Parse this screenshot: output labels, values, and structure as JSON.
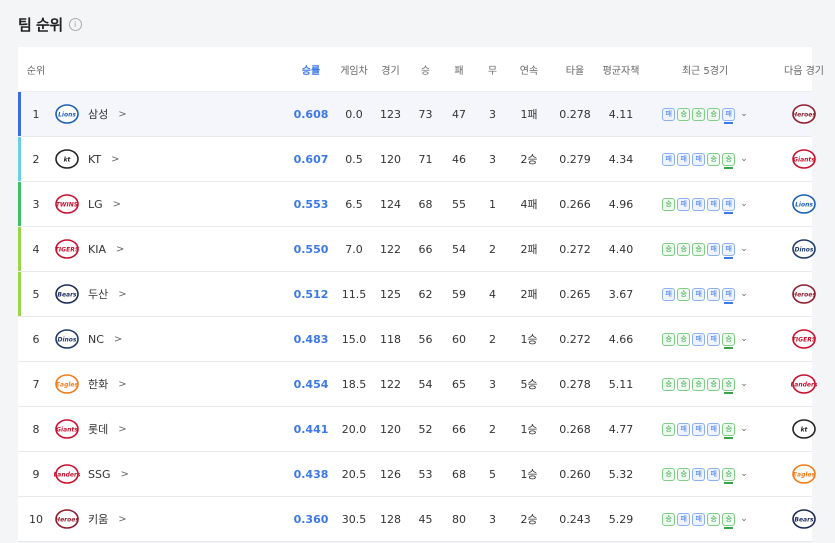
{
  "page_title": "팀 순위",
  "info_icon": "i",
  "columns": {
    "rank": "순위",
    "pct": "승률",
    "gb": "게임차",
    "games": "경기",
    "wins": "승",
    "losses": "패",
    "draws": "무",
    "streak": "연속",
    "avg": "타율",
    "era": "평균자책",
    "last5": "최근 5경기",
    "next": "다음 경기"
  },
  "teams": [
    {
      "rank": "1",
      "name": "삼성",
      "pct": "0.608",
      "gb": "0.0",
      "games": "123",
      "wins": "73",
      "losses": "47",
      "draws": "3",
      "streak": "1패",
      "avg": "0.278",
      "era": "4.11",
      "last5": [
        "패",
        "승",
        "승",
        "승",
        "패"
      ],
      "bar": "#3c6be0",
      "logo": "Lions",
      "logo_color": "#1a5fb4",
      "next_logo": "Heroes",
      "next_color": "#8e1c2e"
    },
    {
      "rank": "2",
      "name": "KT",
      "pct": "0.607",
      "gb": "0.5",
      "games": "120",
      "wins": "71",
      "losses": "46",
      "draws": "3",
      "streak": "2승",
      "avg": "0.279",
      "era": "4.34",
      "last5": [
        "패",
        "패",
        "패",
        "승",
        "승"
      ],
      "bar": "#6bd0e6",
      "logo": "kt",
      "logo_color": "#222",
      "next_logo": "Giants",
      "next_color": "#c8102e"
    },
    {
      "rank": "3",
      "name": "LG",
      "pct": "0.553",
      "gb": "6.5",
      "games": "124",
      "wins": "68",
      "losses": "55",
      "draws": "1",
      "streak": "4패",
      "avg": "0.266",
      "era": "4.96",
      "last5": [
        "승",
        "패",
        "패",
        "패",
        "패"
      ],
      "bar": "#3fbd6a",
      "logo": "TWINS",
      "logo_color": "#c8102e",
      "next_logo": "Lions",
      "next_color": "#1a5fb4"
    },
    {
      "rank": "4",
      "name": "KIA",
      "pct": "0.550",
      "gb": "7.0",
      "games": "122",
      "wins": "66",
      "losses": "54",
      "draws": "2",
      "streak": "2패",
      "avg": "0.272",
      "era": "4.40",
      "last5": [
        "승",
        "승",
        "승",
        "패",
        "패"
      ],
      "bar": "#9ad64a",
      "logo": "TIGERS",
      "logo_color": "#c8102e",
      "next_logo": "Dinos",
      "next_color": "#1f3a6b"
    },
    {
      "rank": "5",
      "name": "두산",
      "pct": "0.512",
      "gb": "11.5",
      "games": "125",
      "wins": "62",
      "losses": "59",
      "draws": "4",
      "streak": "2패",
      "avg": "0.265",
      "era": "3.67",
      "last5": [
        "패",
        "승",
        "패",
        "패",
        "패"
      ],
      "bar": "#9ad64a",
      "logo": "Bears",
      "logo_color": "#1c2a5a",
      "next_logo": "Heroes",
      "next_color": "#8e1c2e"
    },
    {
      "rank": "6",
      "name": "NC",
      "pct": "0.483",
      "gb": "15.0",
      "games": "118",
      "wins": "56",
      "losses": "60",
      "draws": "2",
      "streak": "1승",
      "avg": "0.272",
      "era": "4.66",
      "last5": [
        "승",
        "승",
        "패",
        "패",
        "승"
      ],
      "bar": "",
      "logo": "Dinos",
      "logo_color": "#1f3a6b",
      "next_logo": "TIGERS",
      "next_color": "#c8102e"
    },
    {
      "rank": "7",
      "name": "한화",
      "pct": "0.454",
      "gb": "18.5",
      "games": "122",
      "wins": "54",
      "losses": "65",
      "draws": "3",
      "streak": "5승",
      "avg": "0.278",
      "era": "5.11",
      "last5": [
        "승",
        "승",
        "승",
        "승",
        "승"
      ],
      "bar": "",
      "logo": "Eagles",
      "logo_color": "#f07c1a",
      "next_logo": "Landers",
      "next_color": "#c8102e"
    },
    {
      "rank": "8",
      "name": "롯데",
      "pct": "0.441",
      "gb": "20.0",
      "games": "120",
      "wins": "52",
      "losses": "66",
      "draws": "2",
      "streak": "1승",
      "avg": "0.268",
      "era": "4.77",
      "last5": [
        "승",
        "패",
        "패",
        "패",
        "승"
      ],
      "bar": "",
      "logo": "Giants",
      "logo_color": "#c8102e",
      "next_logo": "kt",
      "next_color": "#222"
    },
    {
      "rank": "9",
      "name": "SSG",
      "pct": "0.438",
      "gb": "20.5",
      "games": "126",
      "wins": "53",
      "losses": "68",
      "draws": "5",
      "streak": "1승",
      "avg": "0.260",
      "era": "5.32",
      "last5": [
        "승",
        "승",
        "패",
        "패",
        "승"
      ],
      "bar": "",
      "logo": "Landers",
      "logo_color": "#c8102e",
      "next_logo": "Eagles",
      "next_color": "#f07c1a"
    },
    {
      "rank": "10",
      "name": "키움",
      "pct": "0.360",
      "gb": "30.5",
      "games": "128",
      "wins": "45",
      "losses": "80",
      "draws": "3",
      "streak": "2승",
      "avg": "0.243",
      "era": "5.29",
      "last5": [
        "승",
        "패",
        "패",
        "승",
        "승"
      ],
      "bar": "",
      "logo": "Heroes",
      "logo_color": "#8e1c2e",
      "next_logo": "Bears",
      "next_color": "#1c2a5a"
    }
  ],
  "chevron": ">",
  "dropdown": "⌄"
}
